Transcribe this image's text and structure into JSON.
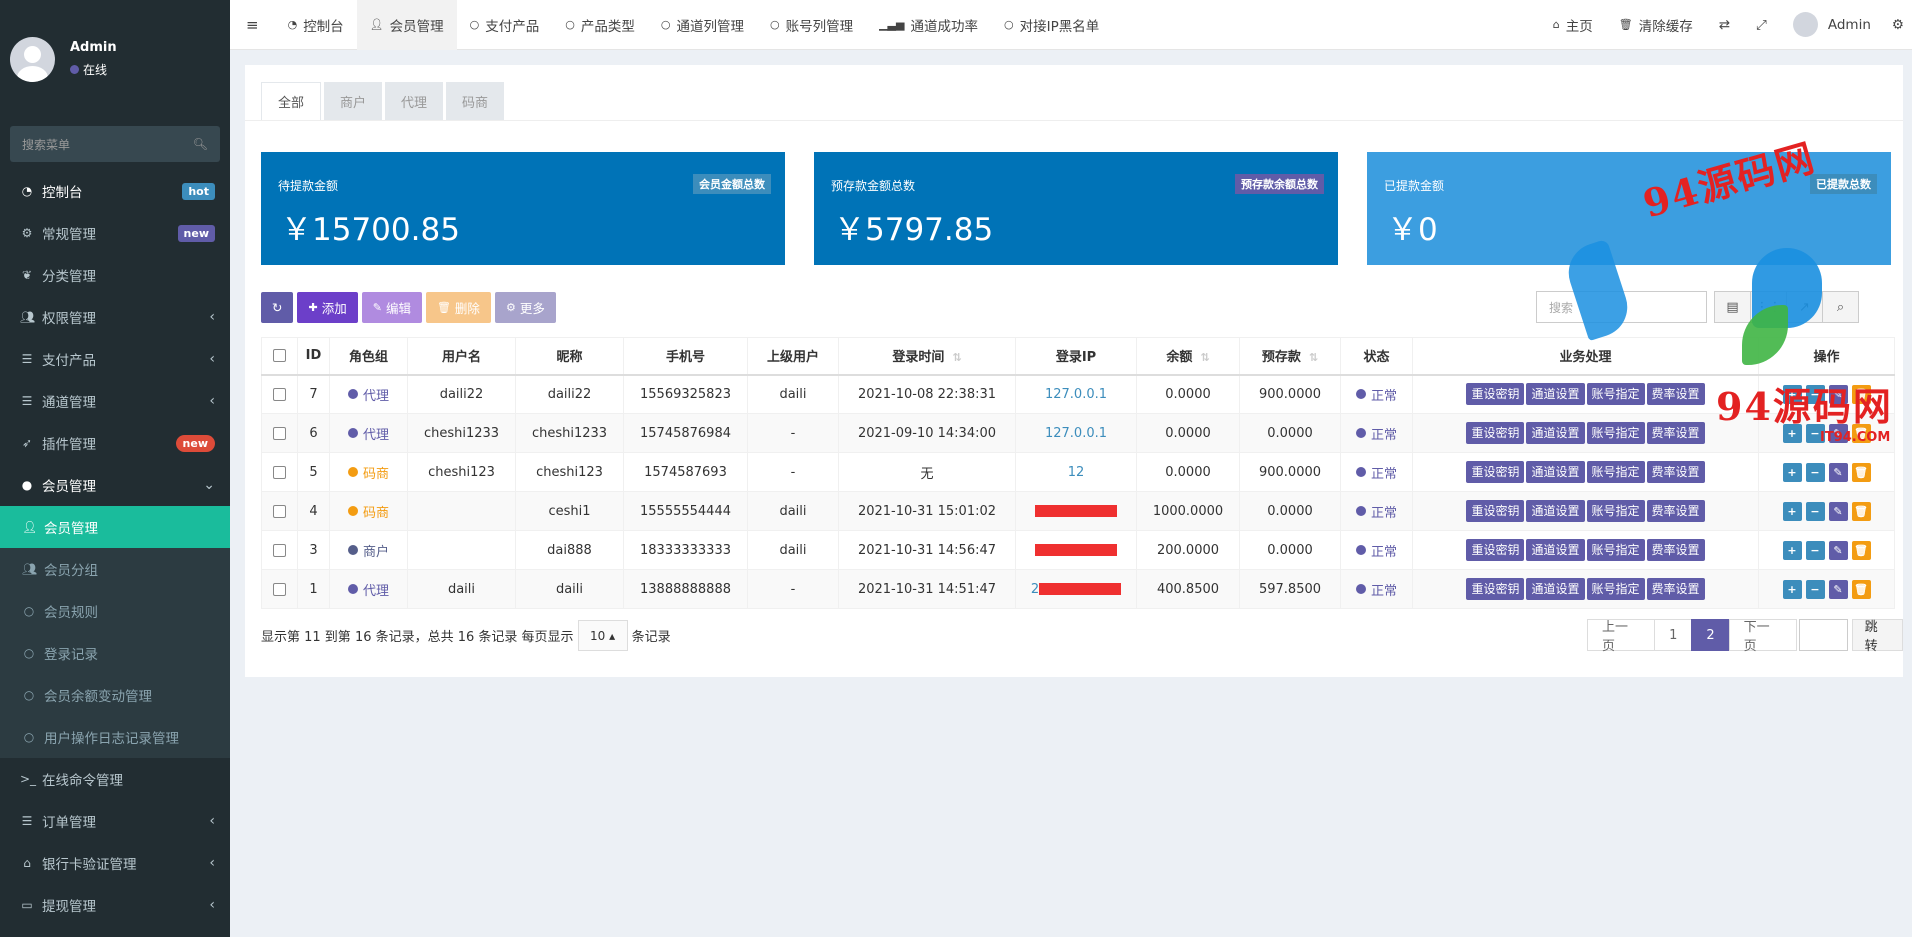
{
  "sidebar": {
    "user": {
      "name": "Admin",
      "status": "在线"
    },
    "search_placeholder": "搜索菜单",
    "items": [
      {
        "label": "控制台",
        "badge": "hot"
      },
      {
        "label": "常规管理",
        "badge": "new"
      },
      {
        "label": "分类管理"
      },
      {
        "label": "权限管理"
      },
      {
        "label": "支付产品"
      },
      {
        "label": "通道管理"
      },
      {
        "label": "插件管理",
        "badge": "new"
      },
      {
        "label": "会员管理"
      },
      {
        "label": "会员管理"
      },
      {
        "label": "会员分组"
      },
      {
        "label": "会员规则"
      },
      {
        "label": "登录记录"
      },
      {
        "label": "会员余额变动管理"
      },
      {
        "label": "用户操作日志记录管理"
      },
      {
        "label": "在线命令管理"
      },
      {
        "label": "订单管理"
      },
      {
        "label": "银行卡验证管理"
      },
      {
        "label": "提现管理"
      }
    ]
  },
  "topbar": {
    "tabs": [
      "控制台",
      "会员管理",
      "支付产品",
      "产品类型",
      "通道列管理",
      "账号列管理",
      "通道成功率",
      "对接IP黑名单"
    ],
    "home": "主页",
    "clear_cache": "清除缓存",
    "user": "Admin"
  },
  "filter_tabs": [
    "全部",
    "商户",
    "代理",
    "码商"
  ],
  "stats": [
    {
      "title": "待提款金额",
      "tag": "会员金额总数",
      "value": "￥15700.85",
      "color": "#0073b7",
      "tag_color": "#3c8dbc"
    },
    {
      "title": "预存款金额总数",
      "tag": "预存款余额总数",
      "value": "￥5797.85",
      "color": "#0073b7",
      "tag_color": "#605ca8"
    },
    {
      "title": "已提款金额",
      "tag": "已提款总数",
      "value": "￥0",
      "color": "#3c9ee0",
      "tag_color": "#3c8dbc"
    }
  ],
  "toolbar": {
    "add": "添加",
    "edit": "编辑",
    "delete": "删除",
    "more": "更多",
    "search_placeholder": "搜索"
  },
  "table": {
    "headers": [
      "ID",
      "角色组",
      "用户名",
      "昵称",
      "手机号",
      "上级用户",
      "登录时间",
      "登录IP",
      "余额",
      "预存款",
      "状态",
      "业务处理",
      "操作"
    ],
    "actions": [
      "重设密钥",
      "通道设置",
      "账号指定",
      "费率设置"
    ],
    "rows": [
      {
        "id": "7",
        "role": "代理",
        "role_color": "#605ca8",
        "username": "daili22",
        "nickname": "daili22",
        "phone": "15569325823",
        "parent": "daili",
        "login_time": "2021-10-08 22:38:31",
        "ip": "127.0.0.1",
        "balance": "0.0000",
        "deposit": "900.0000",
        "status": "正常"
      },
      {
        "id": "6",
        "role": "代理",
        "role_color": "#605ca8",
        "username": "cheshi1233",
        "nickname": "cheshi1233",
        "phone": "15745876984",
        "parent": "-",
        "login_time": "2021-09-10 14:34:00",
        "ip": "127.0.0.1",
        "balance": "0.0000",
        "deposit": "0.0000",
        "status": "正常"
      },
      {
        "id": "5",
        "role": "码商",
        "role_color": "#f39c12",
        "username": "cheshi123",
        "nickname": "cheshi123",
        "phone": "1574587693",
        "parent": "-",
        "login_time": "无",
        "ip": "12",
        "balance": "0.0000",
        "deposit": "900.0000",
        "status": "正常"
      },
      {
        "id": "4",
        "role": "码商",
        "role_color": "#f39c12",
        "username": "",
        "nickname": "ceshi1",
        "phone": "15555554444",
        "parent": "daili",
        "login_time": "2021-10-31 15:01:02",
        "ip": "",
        "balance": "1000.0000",
        "deposit": "0.0000",
        "status": "正常"
      },
      {
        "id": "3",
        "role": "商户",
        "role_color": "#555e8a",
        "username": "",
        "nickname": "dai888",
        "phone": "18333333333",
        "parent": "daili",
        "login_time": "2021-10-31 14:56:47",
        "ip": "",
        "balance": "200.0000",
        "deposit": "0.0000",
        "status": "正常"
      },
      {
        "id": "1",
        "role": "代理",
        "role_color": "#605ca8",
        "username": "daili",
        "nickname": "daili",
        "phone": "13888888888",
        "parent": "-",
        "login_time": "2021-10-31 14:51:47",
        "ip": "2",
        "balance": "400.8500",
        "deposit": "597.8500",
        "status": "正常"
      }
    ]
  },
  "pagination": {
    "info": "显示第 11 到第 16 条记录，总共 16 条记录 每页显示",
    "per_page": "10",
    "suffix": "条记录",
    "prev": "上一页",
    "pages": [
      "1",
      "2"
    ],
    "next": "下一页",
    "jump": "跳转"
  },
  "watermark": {
    "text": "94源码网",
    "sub": "IT94.COM"
  }
}
